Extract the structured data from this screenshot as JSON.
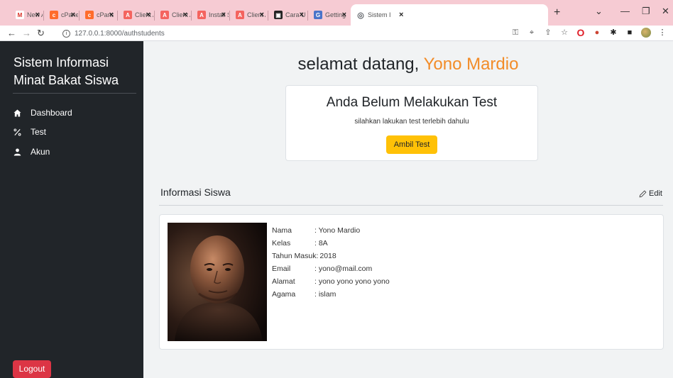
{
  "browser": {
    "tabs": [
      {
        "title": "New Ac",
        "favicon": "gmail-icon",
        "color": "#d93025",
        "glyph": "M"
      },
      {
        "title": "cPanel -",
        "favicon": "cpanel-icon",
        "color": "#ff6c2c",
        "glyph": "cP"
      },
      {
        "title": "cPanel -",
        "favicon": "cpanel-icon",
        "color": "#ff6c2c",
        "glyph": "cP"
      },
      {
        "title": "Client A",
        "favicon": "laravel-icon",
        "color": "#f4645f",
        "glyph": "A"
      },
      {
        "title": "Client A",
        "favicon": "laravel-icon",
        "color": "#f4645f",
        "glyph": "A"
      },
      {
        "title": "Install SI",
        "favicon": "laravel-icon",
        "color": "#f4645f",
        "glyph": "A"
      },
      {
        "title": "Client A",
        "favicon": "laravel-icon",
        "color": "#f4645f",
        "glyph": "A"
      },
      {
        "title": "Cara Up",
        "favicon": "video-icon",
        "color": "#222222",
        "glyph": "▣"
      },
      {
        "title": "Getting",
        "favicon": "docs-icon",
        "color": "#4a74c9",
        "glyph": "G"
      },
      {
        "title": "Sistem I",
        "favicon": "globe-icon",
        "color": "#5f6368",
        "glyph": "◎"
      }
    ],
    "url": "127.0.0.1:8000/authstudents"
  },
  "sidebar": {
    "brand": "Sistem Informasi Minat Bakat Siswa",
    "items": [
      {
        "label": "Dashboard",
        "icon": "home-icon"
      },
      {
        "label": "Test",
        "icon": "percent-icon"
      },
      {
        "label": "Akun",
        "icon": "user-icon"
      }
    ],
    "logout_label": "Logout",
    "logout_color": "#dc3545",
    "bg_color": "#212529"
  },
  "main": {
    "welcome_prefix": "selamat datang,",
    "welcome_name": "Yono Mardio",
    "name_color": "#f28c28",
    "test_card": {
      "title": "Anda Belum Melakukan Test",
      "subtitle": "silahkan lakukan test terlebih dahulu",
      "button_label": "Ambil Test",
      "button_color": "#ffc107"
    },
    "section_title": "Informasi Siswa",
    "edit_label": "Edit",
    "student": {
      "fields": [
        {
          "key": "Nama",
          "value": ": Yono Mardio"
        },
        {
          "key": "Kelas",
          "value": ": 8A"
        },
        {
          "key": "Tahun Masuk:",
          "value": "2018"
        },
        {
          "key": "Email",
          "value": ": yono@mail.com"
        },
        {
          "key": "Alamat",
          "value": ": yono yono yono yono"
        },
        {
          "key": "Agama",
          "value": ": islam"
        }
      ]
    }
  }
}
